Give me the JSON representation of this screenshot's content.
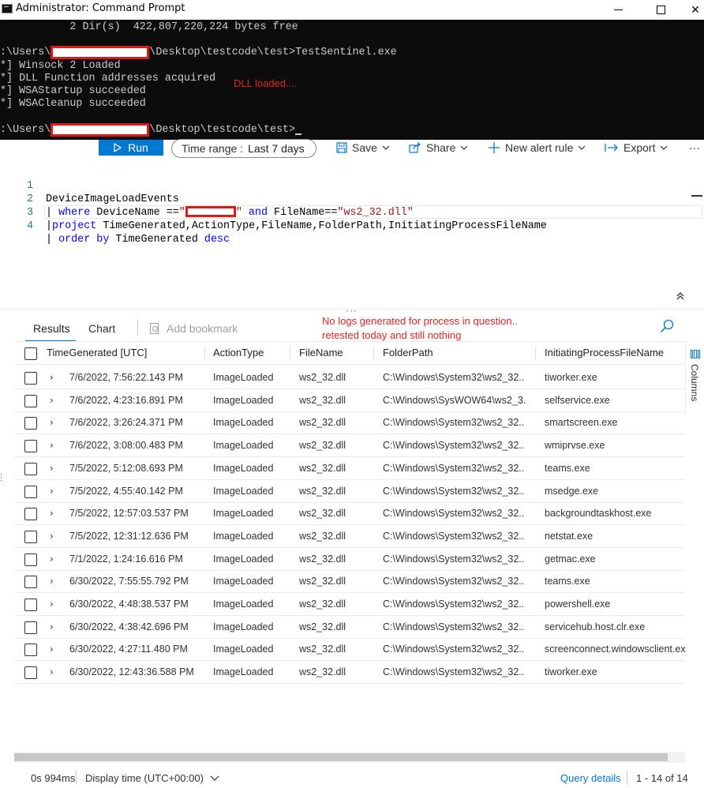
{
  "window": {
    "title": "Administrator: Command Prompt",
    "controls": {
      "minimize": "",
      "maximize": "",
      "close": "✕"
    }
  },
  "console": {
    "line1": "           2 Dir(s)  422,807,220,224 bytes free",
    "prompt_prefix": ":\\Users\\",
    "line3_suffix": "\\Desktop\\testcode\\test>TestSentinel.exe",
    "line4": "*] Winsock 2 Loaded",
    "line5": "*] DLL Function addresses acquired",
    "line6": "*] WSAStartup succeeded",
    "line7": "*] WSACleanup succeeded",
    "line9_suffix": "\\Desktop\\testcode\\test>",
    "annotation": "DLL loaded...."
  },
  "toolbar": {
    "run_label": "Run",
    "time_range_label": "Time range :",
    "time_range_value": "Last 7 days",
    "save_label": "Save",
    "share_label": "Share",
    "new_alert_label": "New alert rule",
    "export_label": "Export",
    "more_label": "···"
  },
  "editor": {
    "line_numbers": [
      "1",
      "2",
      "3",
      "4"
    ],
    "line1": "DeviceImageLoadEvents",
    "line2_pipe": "| ",
    "line2_where": "where",
    "line2_a": " DeviceName ==",
    "line2_q1": "\"",
    "line2_q2": "\"",
    "line2_and": " and ",
    "line2_b": "FileName==",
    "line2_str": "\"ws2_32.dll\"",
    "line3_pipe": "|",
    "line3_project": "project",
    "line3_rest": " TimeGenerated,ActionType,FileName,FolderPath,InitiatingProcessFileName",
    "line4_pipe": "| ",
    "line4_order": "order by",
    "line4_rest": " TimeGenerated ",
    "line4_desc": "desc"
  },
  "results": {
    "tab_results": "Results",
    "tab_chart": "Chart",
    "add_bookmark": "Add bookmark",
    "note_line1": "No logs generated for process in question..",
    "note_line2": "retested today and still nothing",
    "columns_label": "Columns",
    "headers": [
      "TimeGenerated [UTC]",
      "ActionType",
      "FileName",
      "FolderPath",
      "InitiatingProcessFileName"
    ],
    "rows": [
      {
        "time": "7/6/2022, 7:56:22.143 PM",
        "action": "ImageLoaded",
        "file": "ws2_32.dll",
        "folder": "C:\\Windows\\System32\\ws2_32....",
        "proc": "tiworker.exe"
      },
      {
        "time": "7/6/2022, 4:23:16.891 PM",
        "action": "ImageLoaded",
        "file": "ws2_32.dll",
        "folder": "C:\\Windows\\SysWOW64\\ws2_3...",
        "proc": "selfservice.exe"
      },
      {
        "time": "7/6/2022, 3:26:24.371 PM",
        "action": "ImageLoaded",
        "file": "ws2_32.dll",
        "folder": "C:\\Windows\\System32\\ws2_32....",
        "proc": "smartscreen.exe"
      },
      {
        "time": "7/6/2022, 3:08:00.483 PM",
        "action": "ImageLoaded",
        "file": "ws2_32.dll",
        "folder": "C:\\Windows\\System32\\ws2_32....",
        "proc": "wmiprvse.exe"
      },
      {
        "time": "7/5/2022, 5:12:08.693 PM",
        "action": "ImageLoaded",
        "file": "ws2_32.dll",
        "folder": "C:\\Windows\\System32\\ws2_32....",
        "proc": "teams.exe"
      },
      {
        "time": "7/5/2022, 4:55:40.142 PM",
        "action": "ImageLoaded",
        "file": "ws2_32.dll",
        "folder": "C:\\Windows\\System32\\ws2_32....",
        "proc": "msedge.exe"
      },
      {
        "time": "7/5/2022, 12:57:03.537 PM",
        "action": "ImageLoaded",
        "file": "ws2_32.dll",
        "folder": "C:\\Windows\\System32\\ws2_32....",
        "proc": "backgroundtaskhost.exe"
      },
      {
        "time": "7/5/2022, 12:31:12.636 PM",
        "action": "ImageLoaded",
        "file": "ws2_32.dll",
        "folder": "C:\\Windows\\System32\\ws2_32....",
        "proc": "netstat.exe"
      },
      {
        "time": "7/1/2022, 1:24:16.616 PM",
        "action": "ImageLoaded",
        "file": "ws2_32.dll",
        "folder": "C:\\Windows\\System32\\ws2_32....",
        "proc": "getmac.exe"
      },
      {
        "time": "6/30/2022, 7:55:55.792 PM",
        "action": "ImageLoaded",
        "file": "ws2_32.dll",
        "folder": "C:\\Windows\\System32\\ws2_32....",
        "proc": "teams.exe"
      },
      {
        "time": "6/30/2022, 4:48:38.537 PM",
        "action": "ImageLoaded",
        "file": "ws2_32.dll",
        "folder": "C:\\Windows\\System32\\ws2_32....",
        "proc": "powershell.exe"
      },
      {
        "time": "6/30/2022, 4:38:42.696 PM",
        "action": "ImageLoaded",
        "file": "ws2_32.dll",
        "folder": "C:\\Windows\\System32\\ws2_32....",
        "proc": "servicehub.host.clr.exe"
      },
      {
        "time": "6/30/2022, 4:27:11.480 PM",
        "action": "ImageLoaded",
        "file": "ws2_32.dll",
        "folder": "C:\\Windows\\System32\\ws2_32....",
        "proc": "screenconnect.windowsclient.exe"
      },
      {
        "time": "6/30/2022, 12:43:36.588 PM",
        "action": "ImageLoaded",
        "file": "ws2_32.dll",
        "folder": "C:\\Windows\\System32\\ws2_32....",
        "proc": "tiworker.exe"
      }
    ]
  },
  "footer": {
    "elapsed": "0s 994ms",
    "display_time": "Display time (UTC+00:00)",
    "query_details": "Query details",
    "row_count": "1 - 14 of 14"
  },
  "colors": {
    "accent": "#0078d4",
    "annotation_red": "#e02424",
    "console_bg": "#0c0c0c",
    "redaction": "#e01818"
  },
  "icons": {
    "run": "play-icon",
    "save": "save-icon",
    "share": "share-icon",
    "new_alert": "plus-icon",
    "export": "export-icon",
    "search": "search-icon",
    "columns": "columns-icon"
  }
}
